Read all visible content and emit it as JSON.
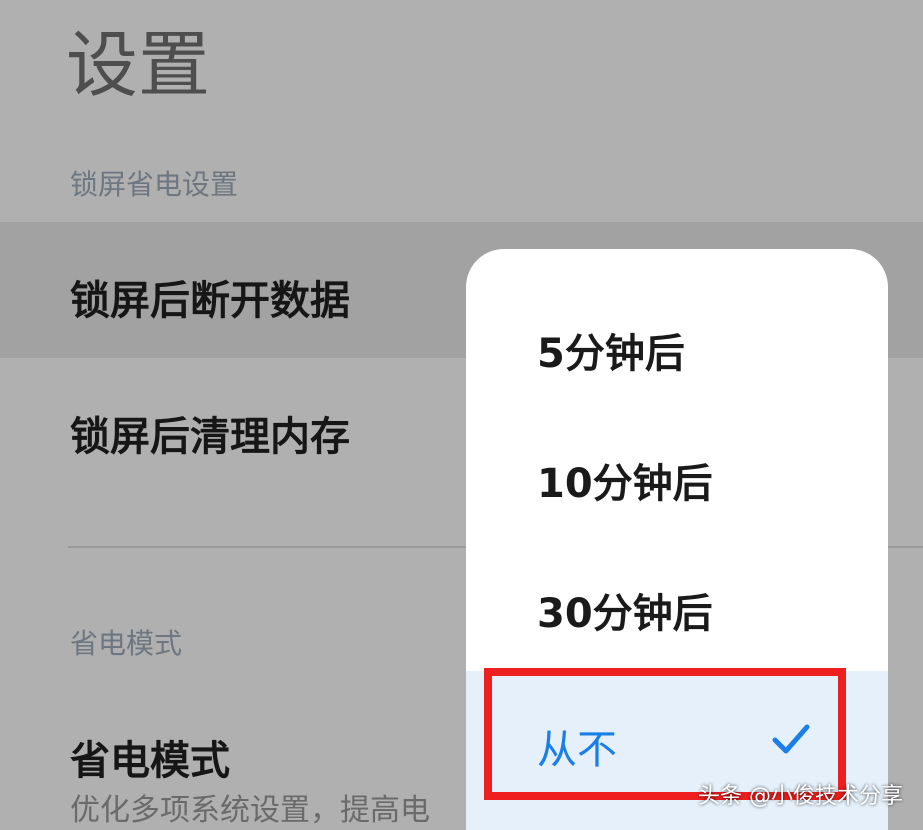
{
  "page_title": "设置",
  "section_lock": "锁屏省电设置",
  "row_disconnect": "锁屏后断开数据",
  "row_clean": "锁屏后清理内存",
  "section_power": "省电模式",
  "row_power_mode": "省电模式",
  "row_power_mode_sub": "优化多项系统设置，提高电",
  "popup_options": [
    "5分钟后",
    "10分钟后",
    "30分钟后",
    "从不"
  ],
  "selected_option": "从不",
  "selected_icon": "checkmark-icon",
  "accent_color": "#1a7fe6",
  "highlight_color": "#ee1f1f",
  "watermark": "头条 @小俊技术分享"
}
